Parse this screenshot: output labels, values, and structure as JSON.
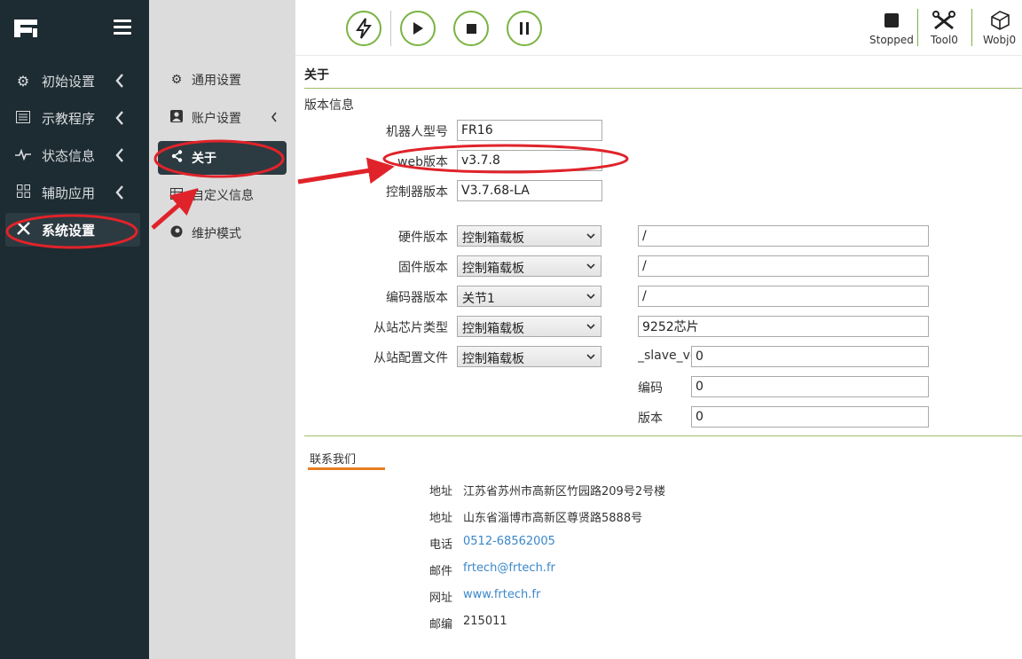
{
  "sidebar": {
    "items": [
      {
        "label": "初始设置",
        "icon": "gear-icon"
      },
      {
        "label": "示教程序",
        "icon": "list-icon"
      },
      {
        "label": "状态信息",
        "icon": "pulse-icon"
      },
      {
        "label": "辅助应用",
        "icon": "grid-icon"
      },
      {
        "label": "系统设置",
        "icon": "tools-icon"
      }
    ]
  },
  "subnav": {
    "items": [
      {
        "label": "通用设置",
        "icon": "gears-icon"
      },
      {
        "label": "账户设置",
        "icon": "user-icon"
      },
      {
        "label": "关于",
        "icon": "share-icon"
      },
      {
        "label": "自定义信息",
        "icon": "table-icon"
      },
      {
        "label": "维护模式",
        "icon": "disc-icon"
      }
    ]
  },
  "toolbar": {
    "status": "Stopped",
    "tool": "Tool0",
    "wobj": "Wobj0",
    "accent": "#7ab341"
  },
  "main": {
    "title": "关于",
    "section": "版本信息",
    "robot_model_label": "机器人型号",
    "robot_model": "FR16",
    "web_version_label": "web版本",
    "web_version": "v3.7.8",
    "controller_version_label": "控制器版本",
    "controller_version": "V3.7.68-LA",
    "hardware_label": "硬件版本",
    "hardware_select": "控制箱载板",
    "hardware_value": "/",
    "firmware_label": "固件版本",
    "firmware_select": "控制箱载板",
    "firmware_value": "/",
    "encoder_label": "编码器版本",
    "encoder_select": "关节1",
    "encoder_value": "/",
    "slave_chip_label": "从站芯片类型",
    "slave_chip_select": "控制箱载板",
    "slave_chip_value": "9252芯片",
    "slave_config_label": "从站配置文件",
    "slave_config_select": "控制箱载板",
    "slave_ver_label": "_slave_ve",
    "slave_ver_value": "0",
    "code_label": "编码",
    "code_value": "0",
    "version_label": "版本",
    "version_value": "0"
  },
  "contact": {
    "tab": "联系我们",
    "rows": [
      {
        "label": "地址",
        "value": "江苏省苏州市高新区竹园路209号2号楼"
      },
      {
        "label": "地址",
        "value": "山东省淄博市高新区尊贤路5888号"
      },
      {
        "label": "电话",
        "value": "0512-68562005"
      },
      {
        "label": "邮件",
        "value": "frtech@frtech.fr"
      },
      {
        "label": "网址",
        "value": "www.frtech.fr"
      },
      {
        "label": "邮编",
        "value": "215011"
      }
    ]
  }
}
